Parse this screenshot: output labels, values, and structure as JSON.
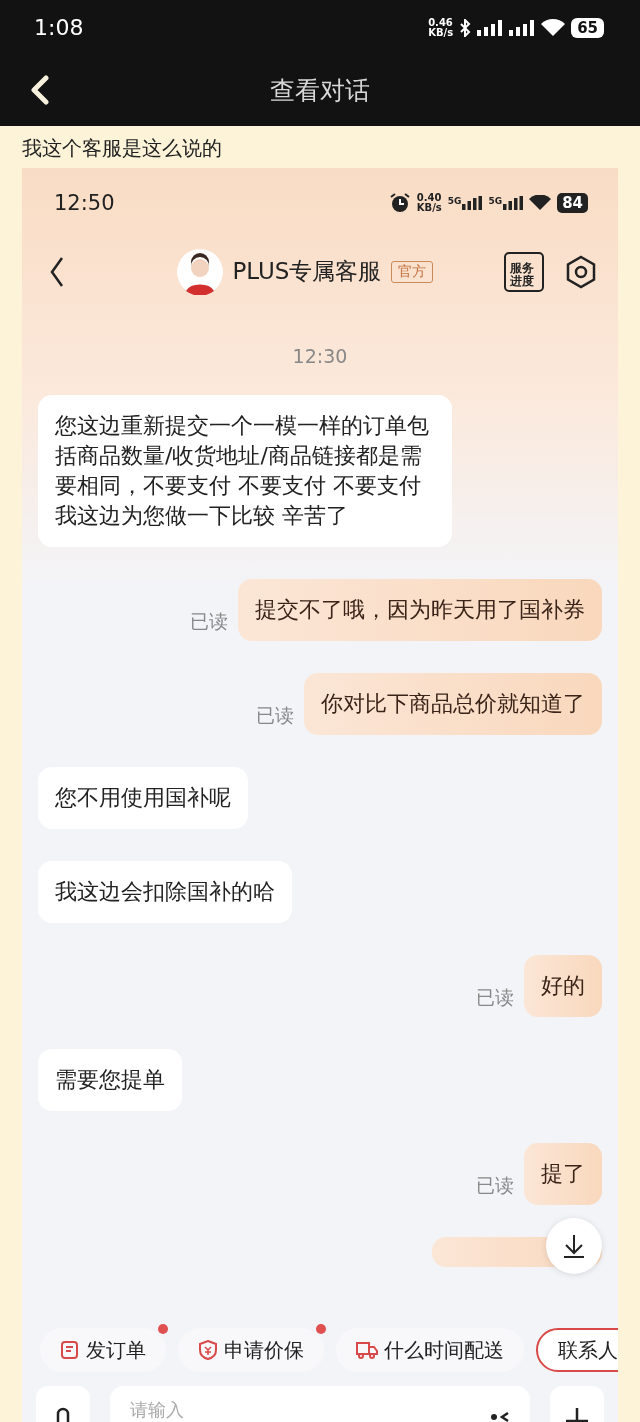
{
  "status_bar": {
    "time": "1:08",
    "net_speed": [
      "0.46",
      "KB/s"
    ],
    "battery": "65"
  },
  "header": {
    "title": "查看对话"
  },
  "caption": "我这个客服是这么说的",
  "screenshot": {
    "status_bar": {
      "time": "12:50",
      "net_speed": [
        "0.40",
        "KB/s"
      ],
      "network": [
        "5G",
        "5G"
      ],
      "battery": "84"
    },
    "header": {
      "title": "PLUS专属客服",
      "badge": "官方",
      "service_label": "服务进度"
    },
    "timestamp": "12:30",
    "messages": [
      {
        "kind": "received",
        "text": "您这边重新提交一个一模一样的订单包括商品数量/收货地址/商品链接都是需要相同，不要支付  不要支付  不要支付我这边为您做一下比较 辛苦了"
      },
      {
        "kind": "sent",
        "text": "提交不了哦，因为昨天用了国补券",
        "status": "已读"
      },
      {
        "kind": "sent",
        "text": "你对比下商品总价就知道了",
        "status": "已读"
      },
      {
        "kind": "received",
        "text": "您不用使用国补呢"
      },
      {
        "kind": "received",
        "text": "我这边会扣除国补的哈"
      },
      {
        "kind": "sent",
        "text": "好的",
        "status": "已读"
      },
      {
        "kind": "received",
        "text": "需要您提单"
      },
      {
        "kind": "sent",
        "text": "提了",
        "status": "已读"
      }
    ],
    "quick_actions": [
      {
        "kind": "order",
        "label": "发订单",
        "dot": true
      },
      {
        "kind": "shield",
        "label": "申请价保",
        "dot": true
      },
      {
        "kind": "truck",
        "label": "什么时间配送",
        "dot": false
      },
      {
        "kind": "outlined",
        "label": "联系人",
        "dot": false
      }
    ],
    "input": {
      "placeholder": "请输入"
    }
  }
}
